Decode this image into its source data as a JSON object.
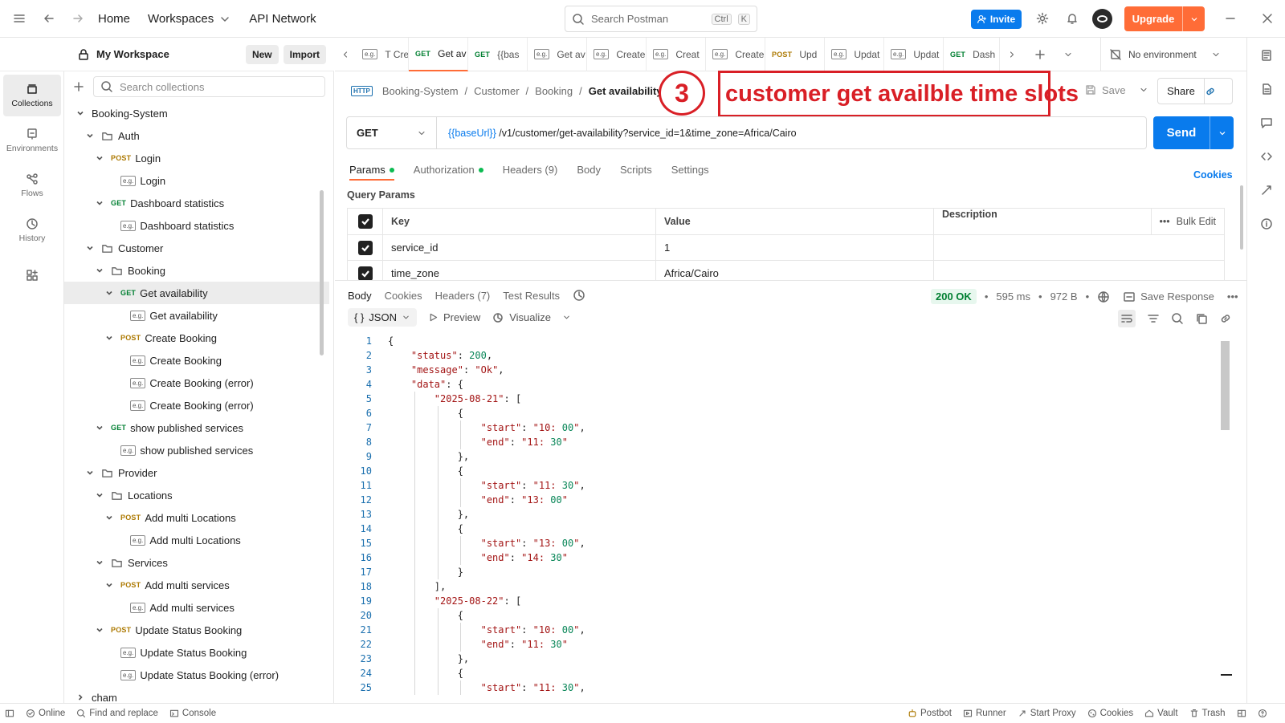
{
  "topbar": {
    "home": "Home",
    "workspaces": "Workspaces",
    "api_network": "API Network",
    "search_placeholder": "Search Postman",
    "search_kbd1": "Ctrl",
    "search_kbd2": "K",
    "invite": "Invite",
    "upgrade": "Upgrade"
  },
  "rail": {
    "items": [
      {
        "label": "Collections",
        "icon": "collections-icon"
      },
      {
        "label": "Environments",
        "icon": "environments-icon"
      },
      {
        "label": "Flows",
        "icon": "flows-icon"
      },
      {
        "label": "History",
        "icon": "history-icon"
      }
    ]
  },
  "workspace": {
    "name": "My Workspace",
    "new": "New",
    "import": "Import",
    "search_placeholder": "Search collections"
  },
  "tree": [
    {
      "label": "Booking-System",
      "level": 0,
      "type": "root",
      "open": true
    },
    {
      "label": "Auth",
      "level": 1,
      "type": "folder",
      "open": true
    },
    {
      "label": "Login",
      "level": 2,
      "type": "request",
      "method": "POST",
      "open": true
    },
    {
      "label": "Login",
      "level": 3,
      "type": "example"
    },
    {
      "label": "Dashboard statistics",
      "level": 2,
      "type": "request",
      "method": "GET",
      "open": true
    },
    {
      "label": "Dashboard statistics",
      "level": 3,
      "type": "example"
    },
    {
      "label": "Customer",
      "level": 1,
      "type": "folder",
      "open": true
    },
    {
      "label": "Booking",
      "level": 2,
      "type": "folder",
      "open": true
    },
    {
      "label": "Get availability",
      "level": 3,
      "type": "request",
      "method": "GET",
      "open": true,
      "selected": true
    },
    {
      "label": "Get availability",
      "level": 4,
      "type": "example"
    },
    {
      "label": "Create Booking",
      "level": 3,
      "type": "request",
      "method": "POST",
      "open": true
    },
    {
      "label": "Create Booking",
      "level": 4,
      "type": "example"
    },
    {
      "label": "Create Booking (error)",
      "level": 4,
      "type": "example"
    },
    {
      "label": "Create Booking (error)",
      "level": 4,
      "type": "example"
    },
    {
      "label": "show published services",
      "level": 2,
      "type": "request",
      "method": "GET",
      "open": true
    },
    {
      "label": "show published services",
      "level": 3,
      "type": "example"
    },
    {
      "label": "Provider",
      "level": 1,
      "type": "folder",
      "open": true
    },
    {
      "label": "Locations",
      "level": 2,
      "type": "folder",
      "open": true
    },
    {
      "label": "Add multi Locations",
      "level": 3,
      "type": "request",
      "method": "POST",
      "open": true
    },
    {
      "label": "Add multi Locations",
      "level": 4,
      "type": "example"
    },
    {
      "label": "Services",
      "level": 2,
      "type": "folder",
      "open": true
    },
    {
      "label": "Add multi services",
      "level": 3,
      "type": "request",
      "method": "POST",
      "open": true
    },
    {
      "label": "Add multi services",
      "level": 4,
      "type": "example"
    },
    {
      "label": "Update Status Booking",
      "level": 2,
      "type": "request",
      "method": "POST",
      "open": true
    },
    {
      "label": "Update Status Booking",
      "level": 3,
      "type": "example"
    },
    {
      "label": "Update Status Booking (error)",
      "level": 3,
      "type": "example"
    },
    {
      "label": "cham",
      "level": 0,
      "type": "root",
      "open": false
    }
  ],
  "tabs": [
    {
      "method": "",
      "label": "T Crea",
      "dot": false
    },
    {
      "method": "GET",
      "label": "Get av",
      "dot": false,
      "active": true
    },
    {
      "method": "GET",
      "label": "{{bas",
      "dot": true
    },
    {
      "method": "",
      "label": "Get av",
      "dot": false
    },
    {
      "method": "",
      "label": "Create",
      "dot": false
    },
    {
      "method": "",
      "label": "Creat",
      "dot": true
    },
    {
      "method": "",
      "label": "Create",
      "dot": false
    },
    {
      "method": "POST",
      "label": "Upd",
      "dot": false
    },
    {
      "method": "",
      "label": "Updat",
      "dot": false
    },
    {
      "method": "",
      "label": "Updat",
      "dot": false
    },
    {
      "method": "GET",
      "label": "Dash",
      "dot": true
    }
  ],
  "environment": "No environment",
  "breadcrumb": {
    "parts": [
      "Booking-System",
      "Customer",
      "Booking"
    ],
    "current": "Get availability"
  },
  "annotation": {
    "number": "3",
    "text": "customer get availble time slots"
  },
  "actions": {
    "save": "Save",
    "share": "Share"
  },
  "request": {
    "method": "GET",
    "url_var": "{{baseUrl}}",
    "url_rest": " /v1/customer/get-availability?service_id=1&time_zone=Africa/Cairo",
    "send": "Send"
  },
  "req_tabs": [
    "Params",
    "Authorization",
    "Headers (9)",
    "Body",
    "Scripts",
    "Settings"
  ],
  "cookies": "Cookies",
  "query_params": {
    "title": "Query Params",
    "headers": [
      "Key",
      "Value",
      "Description"
    ],
    "bulk_edit": "Bulk Edit",
    "rows": [
      {
        "key": "service_id",
        "value": "1",
        "description": ""
      },
      {
        "key": "time_zone",
        "value": "Africa/Cairo",
        "description": ""
      }
    ]
  },
  "response": {
    "tabs": [
      "Body",
      "Cookies",
      "Headers (7)",
      "Test Results"
    ],
    "status": "200 OK",
    "time": "595 ms",
    "size": "972 B",
    "save_response": "Save Response",
    "format": "JSON",
    "preview": "Preview",
    "visualize": "Visualize",
    "lines": [
      {
        "n": "1",
        "t": "{"
      },
      {
        "n": "2",
        "t": "    \"status\": 200,"
      },
      {
        "n": "3",
        "t": "    \"message\": \"Ok\","
      },
      {
        "n": "4",
        "t": "    \"data\": {"
      },
      {
        "n": "5",
        "t": "        \"2025-08-21\": ["
      },
      {
        "n": "6",
        "t": "            {"
      },
      {
        "n": "7",
        "t": "                \"start\": \"10:00\","
      },
      {
        "n": "8",
        "t": "                \"end\": \"11:30\""
      },
      {
        "n": "9",
        "t": "            },"
      },
      {
        "n": "10",
        "t": "            {"
      },
      {
        "n": "11",
        "t": "                \"start\": \"11:30\","
      },
      {
        "n": "12",
        "t": "                \"end\": \"13:00\""
      },
      {
        "n": "13",
        "t": "            },"
      },
      {
        "n": "14",
        "t": "            {"
      },
      {
        "n": "15",
        "t": "                \"start\": \"13:00\","
      },
      {
        "n": "16",
        "t": "                \"end\": \"14:30\""
      },
      {
        "n": "17",
        "t": "            }"
      },
      {
        "n": "18",
        "t": "        ],"
      },
      {
        "n": "19",
        "t": "        \"2025-08-22\": ["
      },
      {
        "n": "20",
        "t": "            {"
      },
      {
        "n": "21",
        "t": "                \"start\": \"10:00\","
      },
      {
        "n": "22",
        "t": "                \"end\": \"11:30\""
      },
      {
        "n": "23",
        "t": "            },"
      },
      {
        "n": "24",
        "t": "            {"
      },
      {
        "n": "25",
        "t": "                \"start\": \"11:30\","
      }
    ]
  },
  "statusbar": {
    "left": [
      "Online",
      "Find and replace",
      "Console"
    ],
    "right": [
      "Postbot",
      "Runner",
      "Start Proxy",
      "Cookies",
      "Vault",
      "Trash"
    ]
  },
  "colors": {
    "accent": "#ff6c37",
    "primary": "#097bed",
    "get": "#007f31",
    "post": "#ad7a03",
    "annotation": "#d91f26"
  }
}
